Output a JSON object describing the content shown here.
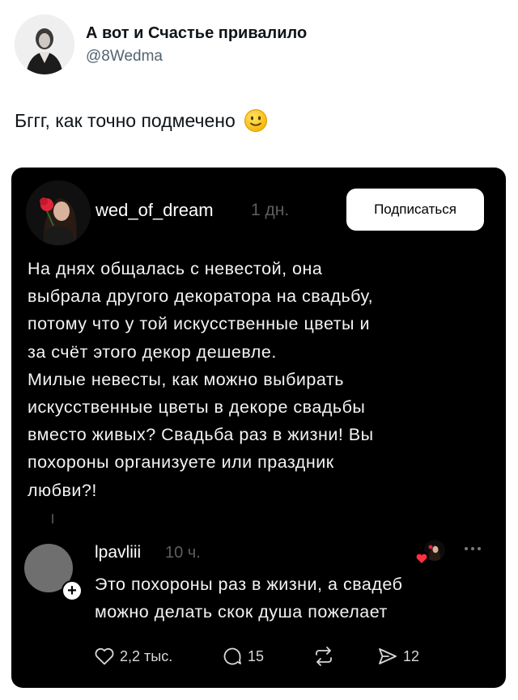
{
  "tweet": {
    "author_name": "А вот и Счастье привалило",
    "author_handle": "@8Wedma",
    "text": "Бггг, как точно подмечено",
    "emoji_icon": "slightly-smiling-face-icon"
  },
  "post": {
    "username": "wed_of_dream",
    "time": "1 дн.",
    "follow_label": "Подписаться",
    "body_lines": [
      "На днях общалась с невестой, она",
      "выбрала другого декоратора на свадьбу,",
      "потому что у той искусственные цветы и",
      "за счёт этого декор дешевле.",
      "Милые невесты, как можно выбирать",
      "искусственные цветы в декоре свадьбы",
      "вместо живых? Свадьба раз в жизни! Вы",
      "похороны организуете или праздник",
      "любви?!"
    ]
  },
  "reply": {
    "username": "lpavliii",
    "time": "10 ч.",
    "body_lines": [
      "Это похороны раз в жизни, а свадеб",
      "можно делать скок душа пожелает"
    ]
  },
  "actions": {
    "likes": "2,2 тыс.",
    "comments": "15",
    "reposts": "",
    "shares": "12"
  },
  "colors": {
    "card_background": "#000000",
    "accent_heart": "#ff3040",
    "muted_text": "#5e5e5e",
    "handle_text": "#536471"
  }
}
